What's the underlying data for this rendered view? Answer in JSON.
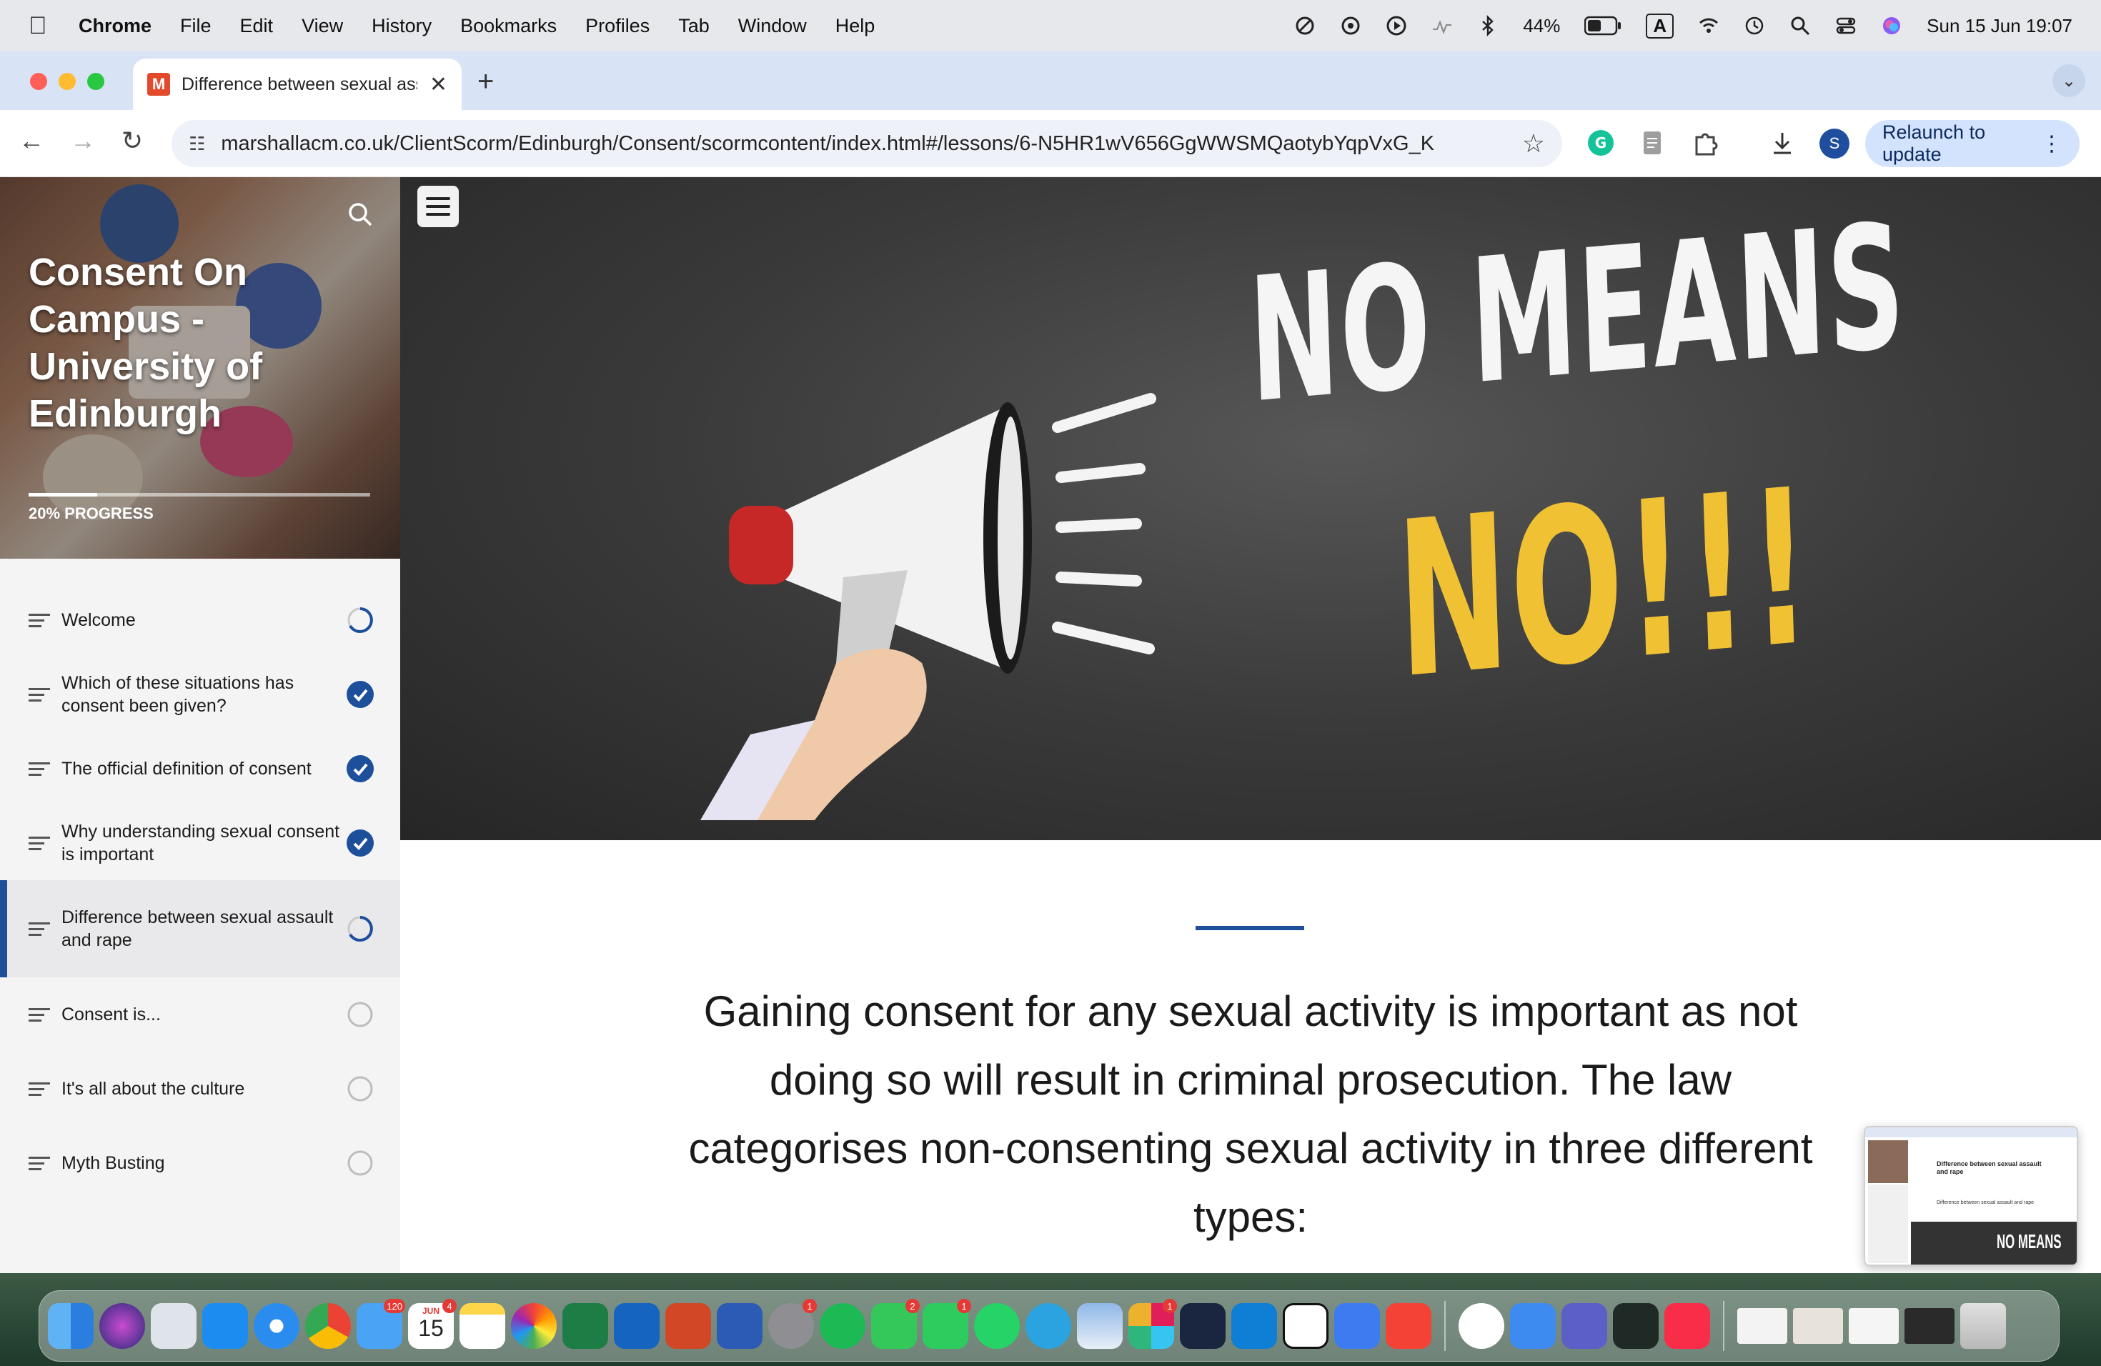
{
  "menubar": {
    "app_name": "Chrome",
    "menus": [
      "File",
      "Edit",
      "View",
      "History",
      "Bookmarks",
      "Profiles",
      "Tab",
      "Window",
      "Help"
    ],
    "battery": "44%",
    "input_source": "A",
    "datetime": "Sun 15 Jun  19:07"
  },
  "browser": {
    "tab_title": "Difference between sexual assault and rape",
    "tab_favicon": "M",
    "url": "marshallacm.co.uk/ClientScorm/Edinburgh/Consent/scormcontent/index.html#/lessons/6-N5HR1wV656GgWWSMQaotybYqpVxG_K",
    "profile_initial": "S",
    "relaunch_label": "Relaunch to update"
  },
  "course": {
    "title": "Consent On Campus - University of Edinburgh",
    "progress_label": "20% PROGRESS",
    "progress_percent": 20
  },
  "lessons": [
    {
      "label": "Welcome",
      "status": "in-progress"
    },
    {
      "label": "Which of these situations has consent been given?",
      "status": "complete"
    },
    {
      "label": "The official definition of consent",
      "status": "complete"
    },
    {
      "label": "Why understanding sexual consent is important",
      "status": "complete"
    },
    {
      "label": "Difference between sexual assault and rape",
      "status": "in-progress",
      "active": true
    },
    {
      "label": "Consent is...",
      "status": "not-started"
    },
    {
      "label": "It's all about the culture",
      "status": "not-started"
    },
    {
      "label": "Myth Busting",
      "status": "not-started"
    }
  ],
  "hero": {
    "line1": "NO MEANS",
    "line2": "NO!!!"
  },
  "content": {
    "body": "Gaining consent for any sexual activity is important as not doing so will result in criminal prosecution.  The law categorises non-consenting sexual activity in three different types:"
  },
  "thumbnail": {
    "heading": "Difference between sexual assault and rape",
    "subheading": "Difference between sexual assault and rape",
    "banner": "NO MEANS"
  },
  "dock": {
    "mail_badge": "120",
    "calendar_month": "JUN",
    "calendar_day": "15",
    "calendar_badge": "4",
    "settings_badge": "1",
    "messages_badge": "2",
    "facetime_badge": "1",
    "slack_badge": "1"
  },
  "colors": {
    "accent": "#1e4f9b",
    "hero_yellow": "#f1c134",
    "relaunch_bg": "#d3e3fd"
  }
}
